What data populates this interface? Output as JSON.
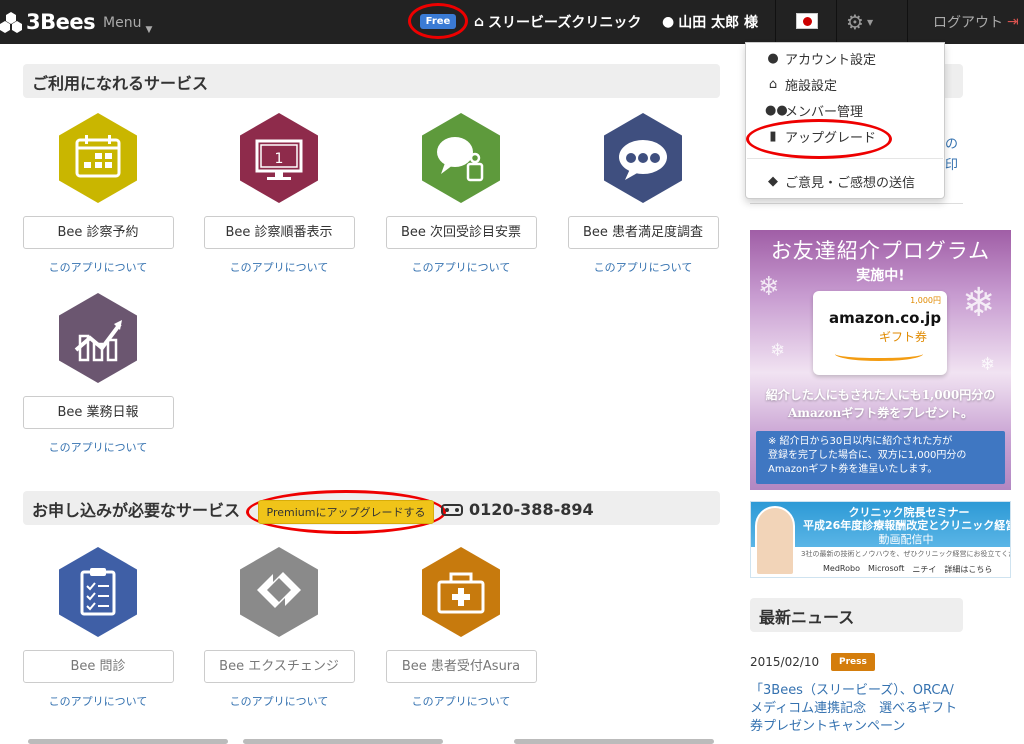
{
  "navbar": {
    "brand": "3Bees",
    "menu_label": "Menu",
    "plan_badge": "Free",
    "clinic_name": "スリービーズクリニック",
    "user_name": "山田 太郎 様",
    "logout_label": "ログアウト"
  },
  "dropdown": {
    "items": [
      {
        "label": "アカウント設定",
        "icon": "user-icon"
      },
      {
        "label": "施設設定",
        "icon": "home-icon"
      },
      {
        "label": "メンバー管理",
        "icon": "users-icon"
      },
      {
        "label": "アップグレード",
        "icon": "bookmark-icon"
      },
      {
        "label": "ご意見・ご感想の送信",
        "icon": "comment-icon"
      }
    ]
  },
  "available_services": {
    "title": "ご利用になれるサービス",
    "apps": [
      {
        "name": "Bee 診察予約",
        "link": "このアプリについて",
        "color": "#c9b600",
        "icon": "calendar-icon"
      },
      {
        "name": "Bee 診察順番表示",
        "link": "このアプリについて",
        "color": "#8e2b4b",
        "icon": "monitor-icon"
      },
      {
        "name": "Bee 次回受診目安票",
        "link": "このアプリについて",
        "color": "#5e9a3c",
        "icon": "speech-person-icon"
      },
      {
        "name": "Bee 患者満足度調査",
        "link": "このアプリについて",
        "color": "#3f4f7f",
        "icon": "faces-bubble-icon"
      },
      {
        "name": "Bee 業務日報",
        "link": "このアプリについて",
        "color": "#6b5670",
        "icon": "chart-icon"
      }
    ]
  },
  "paid_services": {
    "title": "お申し込みが必要なサービス",
    "upgrade_label": "Premiumにアップグレードする",
    "phone": "0120-388-894",
    "apps": [
      {
        "name": "Bee 問診",
        "link": "このアプリについて",
        "color": "#3f5fa6",
        "icon": "clipboard-icon"
      },
      {
        "name": "Bee エクスチェンジ",
        "link": "このアプリについて",
        "color": "#8a8a8a",
        "icon": "exchange-icon"
      },
      {
        "name": "Bee 患者受付Asura",
        "link": "このアプリについて",
        "color": "#c77a0d",
        "icon": "medkit-icon"
      }
    ]
  },
  "sidebar": {
    "partial_link_1": "の",
    "partial_link_2": "印",
    "banner1": {
      "title": "お友達紹介プログラム",
      "subtitle": "実施中!",
      "price": "1,000円",
      "brand": "amazon.co.jp",
      "gift": "ギフト券",
      "text_1": "紹介した人にもされた人にも1,000円分の",
      "text_2": "Amazonギフト券をプレゼント。",
      "note_1": "※ 紹介日から30日以内に紹介された方が",
      "note_2": "登録を完了した場合に、双方に1,000円分の",
      "note_3": "Amazonギフト券を進呈いたします。"
    },
    "banner2": {
      "line1": "クリニック院長セミナー",
      "line2": "平成26年度診療報酬改定とクリニック経営",
      "line3": "動画配信中",
      "line4": "3社の最新の技術とノウハウを、ぜひクリニック経営にお役立てください。",
      "logo1": "MedRobo",
      "logo2": "Microsoft",
      "logo3": "ニチイ",
      "logo4": "詳細はこちら"
    },
    "news": {
      "title": "最新ニュース",
      "date": "2015/02/10",
      "badge": "Press",
      "text": "「3Bees（スリービーズ）、ORCA/メディコム連携記念　選べるギフト券プレゼントキャンペーン"
    }
  },
  "colors": {
    "navbar_bg": "#222222",
    "link": "#3572b0",
    "highlight_circle": "#e00000",
    "upgrade_yellow": "#f0c419",
    "press_badge": "#d47d0c"
  }
}
